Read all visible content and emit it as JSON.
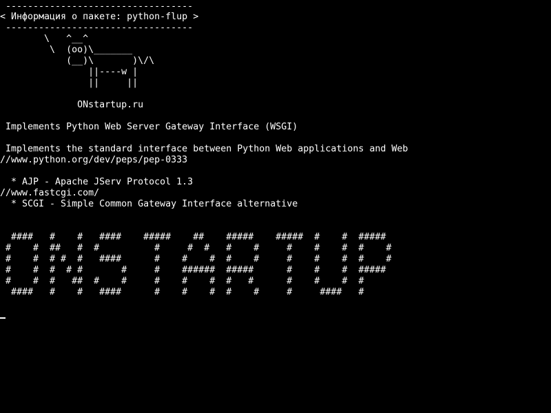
{
  "terminal": {
    "background": "#000000",
    "foreground": "#ffffff",
    "lines": [
      " ----------------------------------",
      "< Информация о пакете: python-flup >",
      " ----------------------------------",
      "        \\   ^__^",
      "         \\  (oo)\\_______",
      "            (__)\\       )\\/\\",
      "                ||----w |",
      "                ||     ||",
      "",
      "              ONstartup.ru",
      "",
      " Implements Python Web Server Gateway Interface (WSGI)",
      "",
      " Implements the standard interface between Python Web applications and Web",
      "//www.python.org/dev/peps/pep-0333",
      "",
      "  * AJP - Apache JServ Protocol 1.3",
      "//www.fastcgi.com/",
      "  * SCGI - Simple Common Gateway Interface alternative",
      "",
      "",
      "  ####   #    #   ####    #####    ##    #####    #####  #    #  #####",
      " #    #  ##   #  #          #     #  #   #    #     #    #    #  #    #",
      " #    #  # #  #   ####      #    #    #  #    #     #    #    #  #    #",
      " #    #  #  # #       #     #    ######  #####      #    #    #  #####",
      " #    #  #   ##  #    #     #    #    #  #   #      #    #    #  #",
      "  ####   #    #   ####      #    #    #  #    #     #     ####   #"
    ]
  }
}
